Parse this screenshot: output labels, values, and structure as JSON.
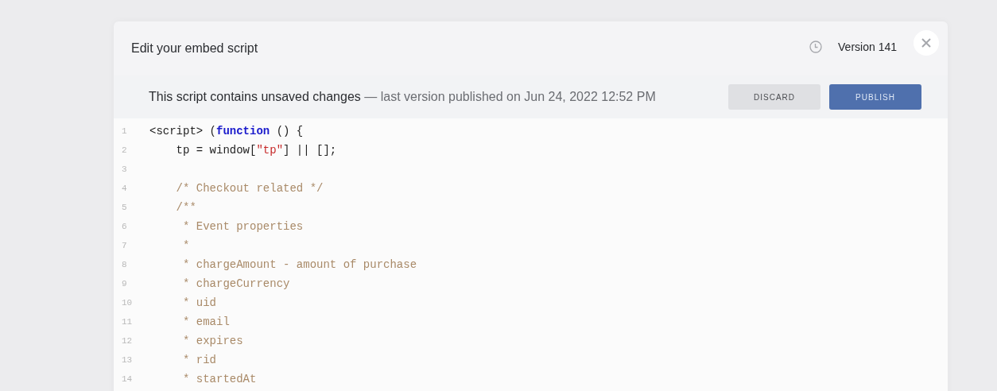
{
  "dialog": {
    "title": "Edit your embed script",
    "version": "Version 141"
  },
  "banner": {
    "message": "This script contains unsaved changes",
    "detail": "— last version published on Jun 24, 2022 12:52 PM",
    "buttons": [
      {
        "label": "DISCARD",
        "kind": "secondary"
      },
      {
        "label": "PUBLISH",
        "kind": "primary"
      }
    ]
  },
  "code": [
    {
      "number": "1",
      "tokens": [
        {
          "kind": "plain",
          "text": "<script> ("
        },
        {
          "kind": "keyword",
          "text": "function"
        },
        {
          "kind": "plain",
          "text": " () {"
        }
      ]
    },
    {
      "number": "2",
      "tokens": [
        {
          "kind": "plain",
          "text": "    tp = window["
        },
        {
          "kind": "string",
          "text": "\"tp\""
        },
        {
          "kind": "plain",
          "text": "] || [];"
        }
      ]
    },
    {
      "number": "3"
    },
    {
      "number": "4",
      "tokens": [
        {
          "kind": "comment",
          "text": "    /* Checkout related */"
        }
      ]
    },
    {
      "number": "5",
      "tokens": [
        {
          "kind": "comment",
          "text": "    /**"
        }
      ]
    },
    {
      "number": "6",
      "tokens": [
        {
          "kind": "comment",
          "text": "     * Event properties"
        }
      ]
    },
    {
      "number": "7",
      "tokens": [
        {
          "kind": "comment",
          "text": "     *"
        }
      ]
    },
    {
      "number": "8",
      "tokens": [
        {
          "kind": "comment",
          "text": "     * chargeAmount - amount of purchase"
        }
      ]
    },
    {
      "number": "9",
      "tokens": [
        {
          "kind": "comment",
          "text": "     * chargeCurrency"
        }
      ]
    },
    {
      "number": "10",
      "tokens": [
        {
          "kind": "comment",
          "text": "     * uid"
        }
      ]
    },
    {
      "number": "11",
      "tokens": [
        {
          "kind": "comment",
          "text": "     * email"
        }
      ]
    },
    {
      "number": "12",
      "tokens": [
        {
          "kind": "comment",
          "text": "     * expires"
        }
      ]
    },
    {
      "number": "13",
      "tokens": [
        {
          "kind": "comment",
          "text": "     * rid"
        }
      ]
    },
    {
      "number": "14",
      "tokens": [
        {
          "kind": "comment",
          "text": "     * startedAt"
        }
      ]
    }
  ]
}
